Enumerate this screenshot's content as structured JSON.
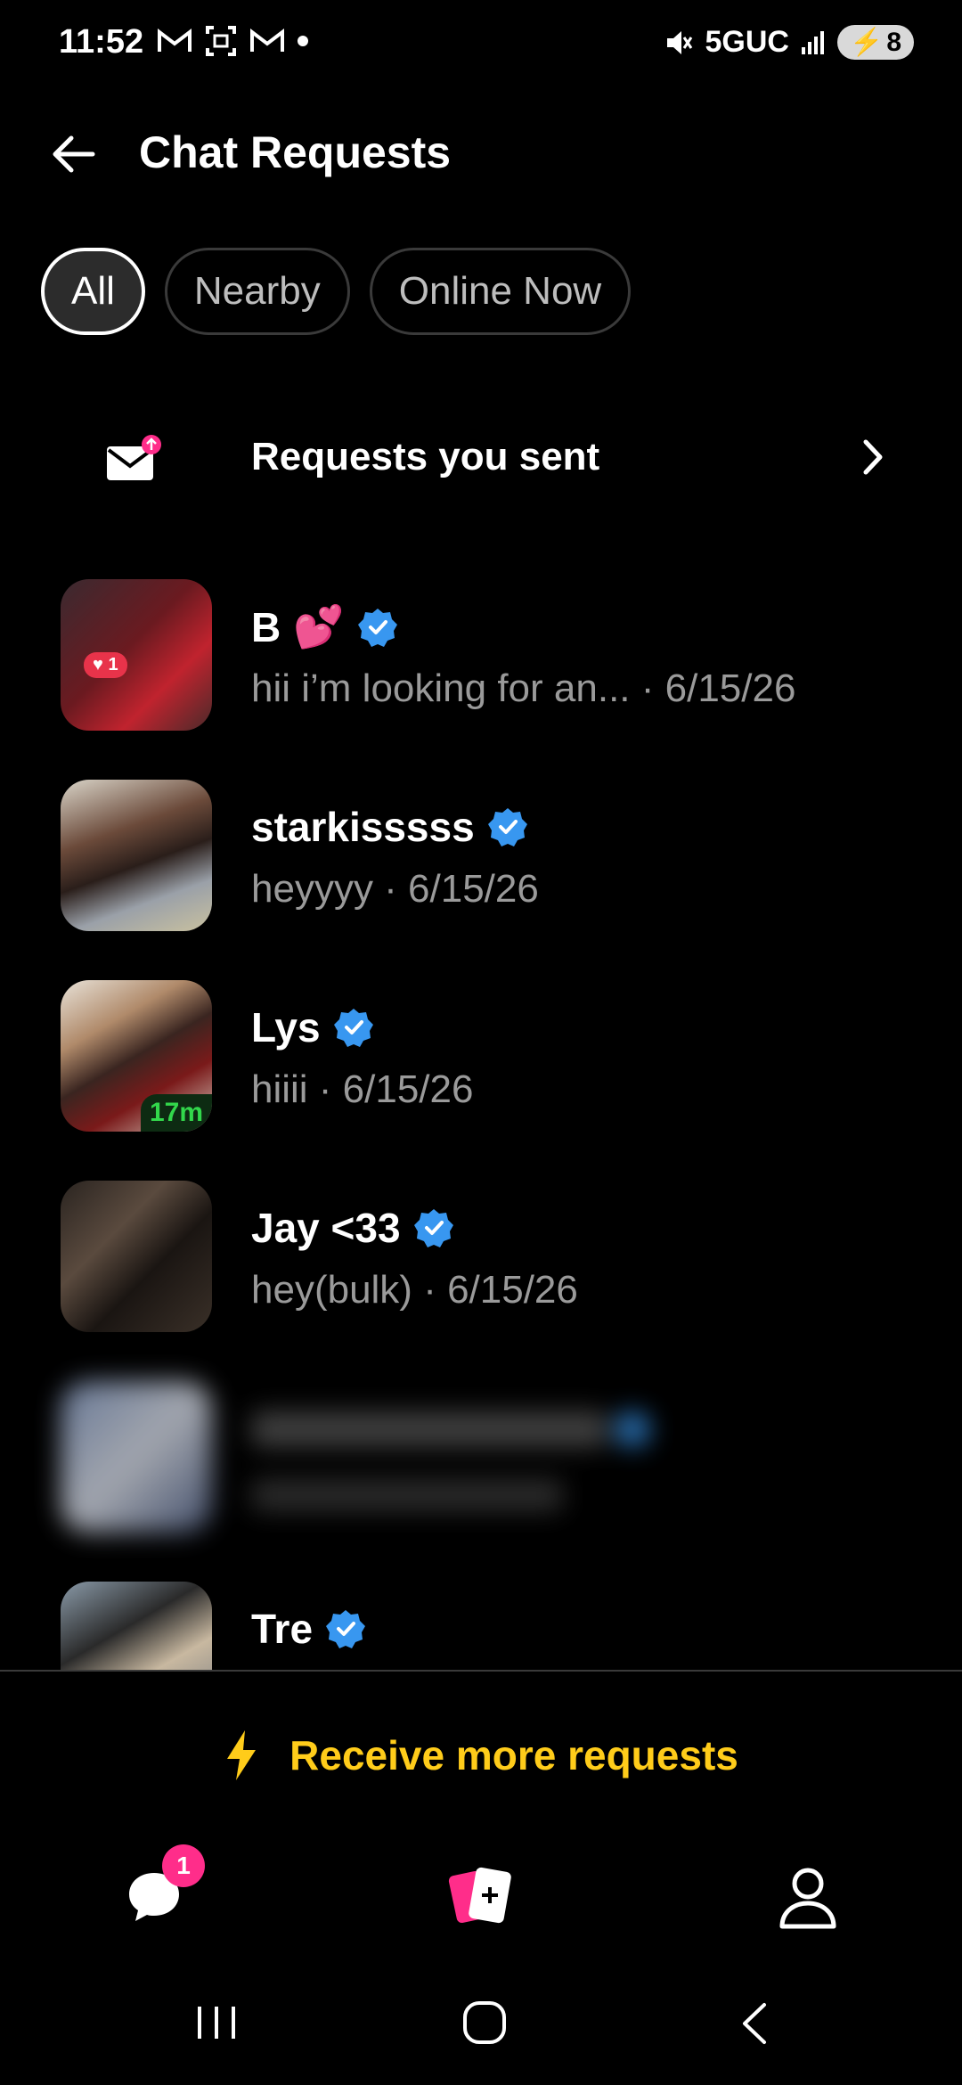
{
  "status_bar": {
    "time": "11:52",
    "network": "5GUC",
    "battery": "8"
  },
  "header": {
    "title": "Chat Requests"
  },
  "filters": [
    {
      "label": "All",
      "active": true
    },
    {
      "label": "Nearby",
      "active": false
    },
    {
      "label": "Online Now",
      "active": false
    }
  ],
  "sent_requests": {
    "label": "Requests you sent"
  },
  "requests": [
    {
      "name": "B",
      "emoji": "💕",
      "verified": true,
      "preview": "hii i’m looking for an... · 6/15/26",
      "like_count": "1"
    },
    {
      "name": "starkisssss",
      "verified": true,
      "preview": "heyyyy · 6/15/26"
    },
    {
      "name": "Lys",
      "verified": true,
      "preview": "hiiii · 6/15/26",
      "active_badge": "17m"
    },
    {
      "name": "Jay <33",
      "verified": true,
      "preview": "hey(bulk) · 6/15/26"
    },
    {
      "name": "",
      "verified": true,
      "preview": "",
      "blurred": true
    },
    {
      "name": "Tre",
      "verified": true,
      "preview": ""
    }
  ],
  "promo": {
    "label": "Receive more requests",
    "color": "#ffcc1a"
  },
  "tabs": {
    "chats_badge": "1"
  },
  "colors": {
    "verified": "#3897f0",
    "accent_pink": "#ff2d8a",
    "accent_yellow": "#ffcc1a"
  }
}
